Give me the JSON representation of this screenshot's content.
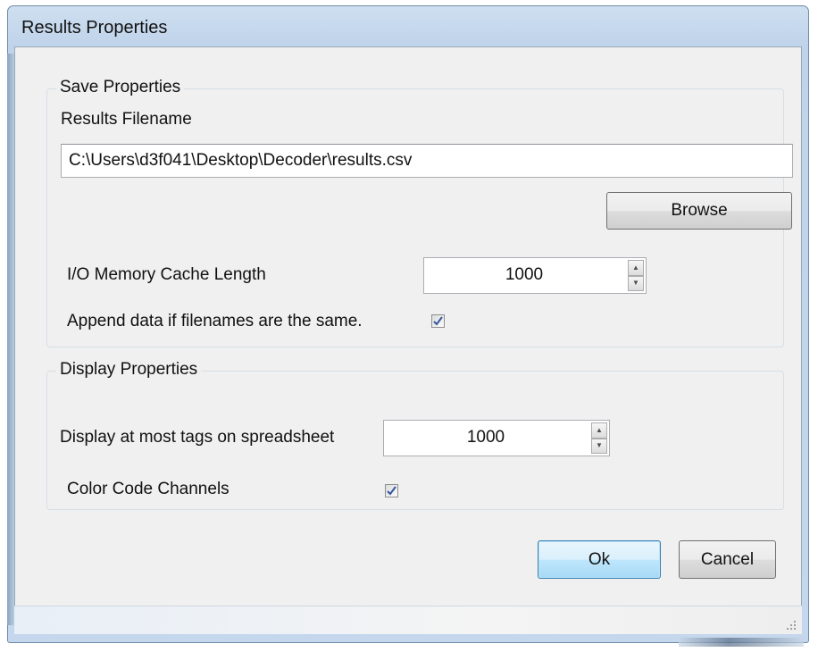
{
  "window": {
    "title": "Results Properties"
  },
  "save_properties": {
    "group_label": "Save Properties",
    "filename_label": "Results Filename",
    "filename_value": "C:\\Users\\d3f041\\Desktop\\Decoder\\results.csv",
    "browse_label": "Browse",
    "cache_label": "I/O Memory Cache Length",
    "cache_value": "1000",
    "append_label": "Append data if filenames are the same.",
    "append_checked": true
  },
  "display_properties": {
    "group_label": "Display Properties",
    "max_tags_label": "Display at most tags on spreadsheet",
    "max_tags_value": "1000",
    "color_code_label": "Color Code Channels",
    "color_code_checked": true
  },
  "buttons": {
    "ok_label": "Ok",
    "cancel_label": "Cancel"
  },
  "icons": {
    "spin_up": "spin-up-arrow",
    "spin_down": "spin-down-arrow",
    "checkmark": "checkmark",
    "resize_grip": "resize-grip"
  },
  "colors": {
    "checkmark": "#3455a0",
    "default_button_border": "#3c7fb1"
  }
}
